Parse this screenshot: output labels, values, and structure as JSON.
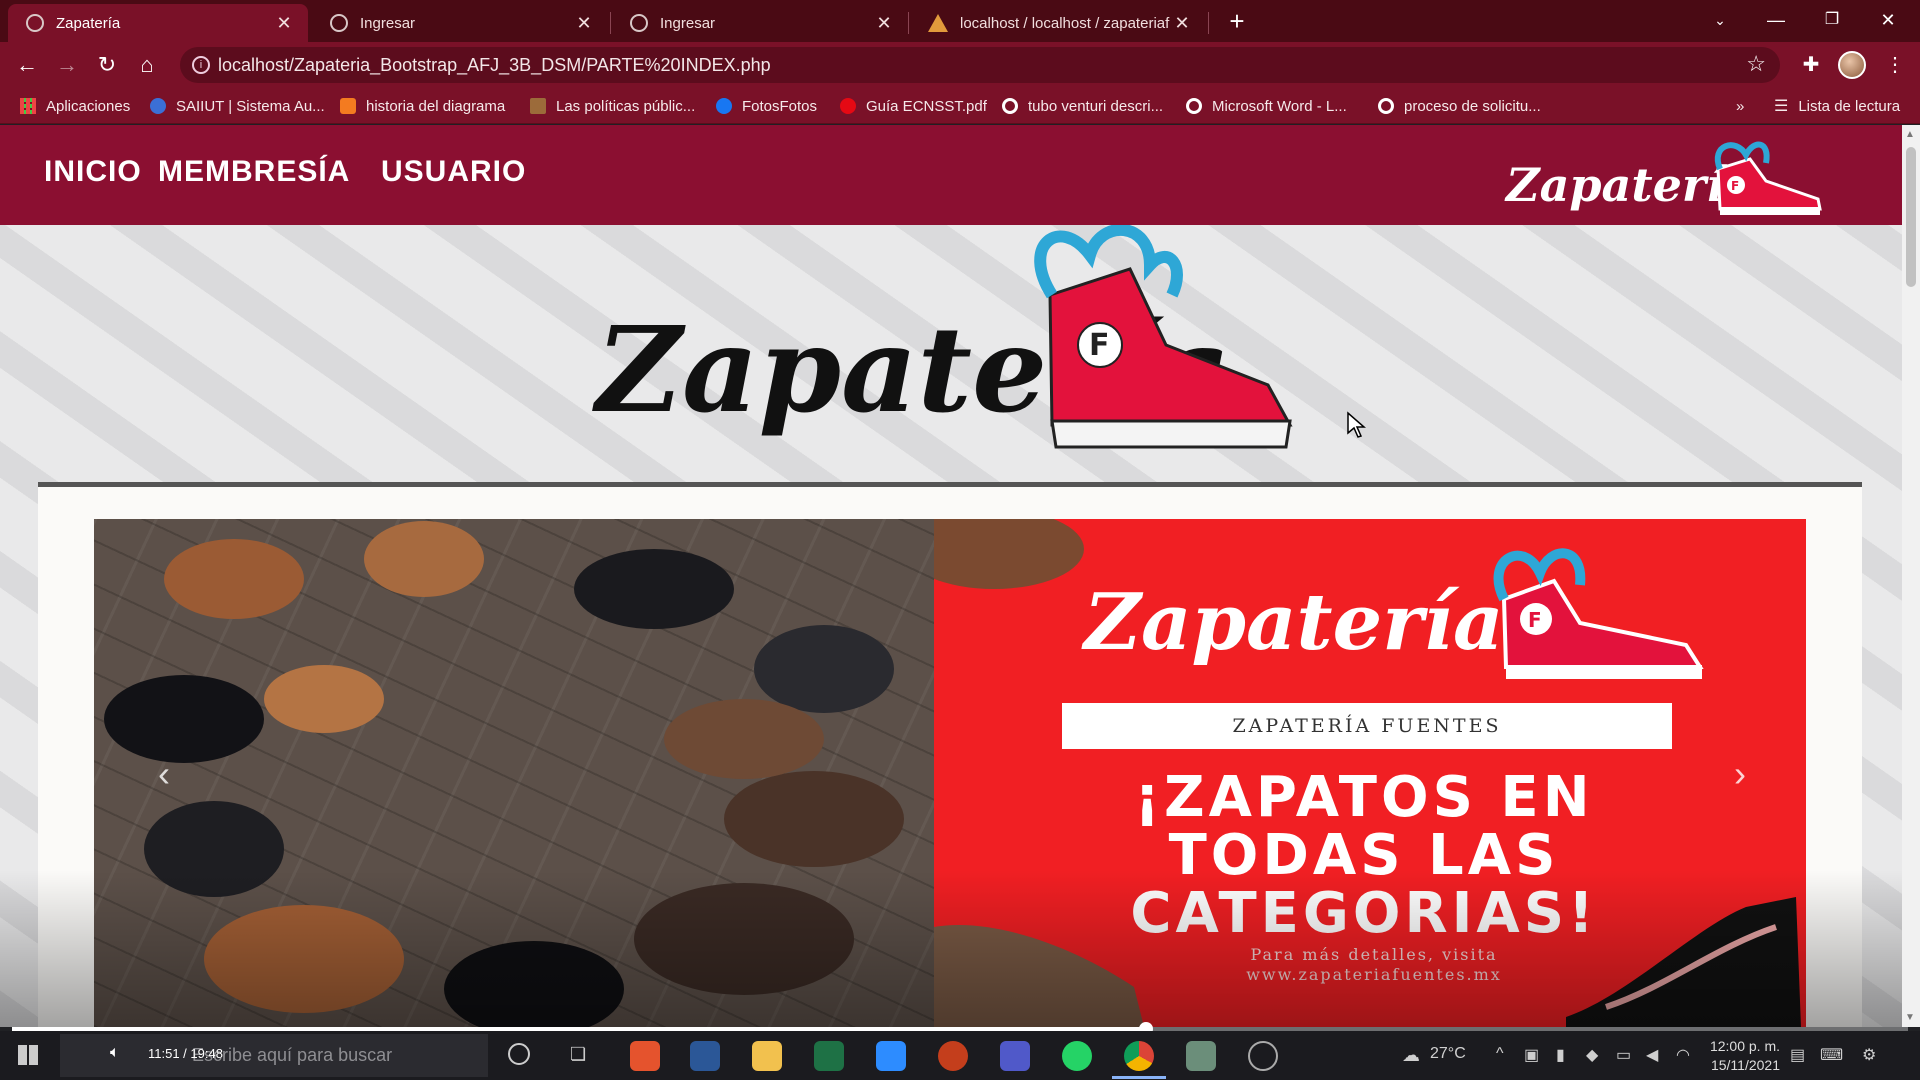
{
  "browser": {
    "tabs": [
      {
        "title": "Zapatería",
        "active": true
      },
      {
        "title": "Ingresar",
        "active": false
      },
      {
        "title": "Ingresar",
        "active": false
      },
      {
        "title": "localhost / localhost / zapateriaf",
        "active": false
      }
    ],
    "url": "localhost/Zapateria_Bootstrap_AFJ_3B_DSM/PARTE%20INDEX.php",
    "bookmarks": [
      {
        "label": "Aplicaciones",
        "color": "#e44d3a"
      },
      {
        "label": "SAIIUT | Sistema Au...",
        "color": "#3b6fd6"
      },
      {
        "label": "historia del diagrama",
        "color": "#f47b20"
      },
      {
        "label": "Las políticas públic...",
        "color": "#9c6b3a"
      },
      {
        "label": "FotosFotos",
        "color": "#1877f2"
      },
      {
        "label": "Guía ECNSST.pdf",
        "color": "#e50914"
      },
      {
        "label": "tubo venturi descri...",
        "color": "#ffffff"
      },
      {
        "label": "Microsoft Word - L...",
        "color": "#ffffff"
      },
      {
        "label": "proceso de solicitu...",
        "color": "#ffffff"
      }
    ],
    "overflow": "»",
    "reading_list": "Lista de lectura"
  },
  "site": {
    "nav": [
      "INICIO",
      "MEMBRESÍA",
      "USUARIO"
    ],
    "brand_color": "#8b0f31",
    "logo_text": "Zapatería",
    "logo_badge": "F",
    "banner": {
      "box_title": "ZAPATERÍA FUENTES",
      "promo_lines": [
        "¡ZAPATOS EN",
        "TODAS LAS",
        "CATEGORIAS!"
      ],
      "details_lines": [
        "Para más detalles, visita",
        "www.zapateriafuentes.mx"
      ]
    },
    "carousel": {
      "prev_icon": "‹",
      "next_icon": "›"
    }
  },
  "video": {
    "time": "11:51 / 19:48",
    "progress_fraction": 0.598
  },
  "taskbar": {
    "search_text": "Escribe aquí para buscar",
    "weather": "27°C",
    "time": "12:00 p. m.",
    "date": "15/11/2021"
  }
}
